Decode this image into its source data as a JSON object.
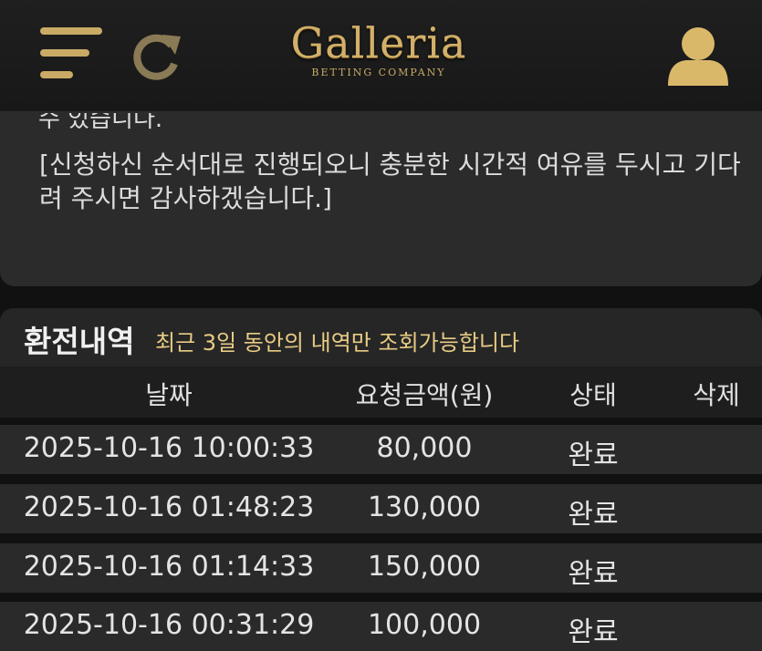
{
  "header": {
    "logo_title": "Galleria",
    "logo_subtitle": "BETTING COMPANY",
    "accent_color": "#c9ab66",
    "icons": [
      "menu-icon",
      "refresh-icon",
      "user-icon"
    ]
  },
  "notice": {
    "cut_line": "수 있습니다.",
    "text": "[신청하신 순서대로 진행되오니 충분한 시간적 여유를 두시고 기다려 주시면 감사하겠습니다.]"
  },
  "history": {
    "title": "환전내역",
    "note": "최근 3일 동안의 내역만 조회가능합니다",
    "columns": {
      "date": "날짜",
      "amount": "요청금액(원)",
      "status": "상태",
      "delete": "삭제"
    },
    "rows": [
      {
        "date": "2025-10-16 10:00:33",
        "amount": "80,000",
        "status": "완료"
      },
      {
        "date": "2025-10-16 01:48:23",
        "amount": "130,000",
        "status": "완료"
      },
      {
        "date": "2025-10-16 01:14:33",
        "amount": "150,000",
        "status": "완료"
      },
      {
        "date": "2025-10-16 00:31:29",
        "amount": "100,000",
        "status": "완료"
      }
    ]
  }
}
